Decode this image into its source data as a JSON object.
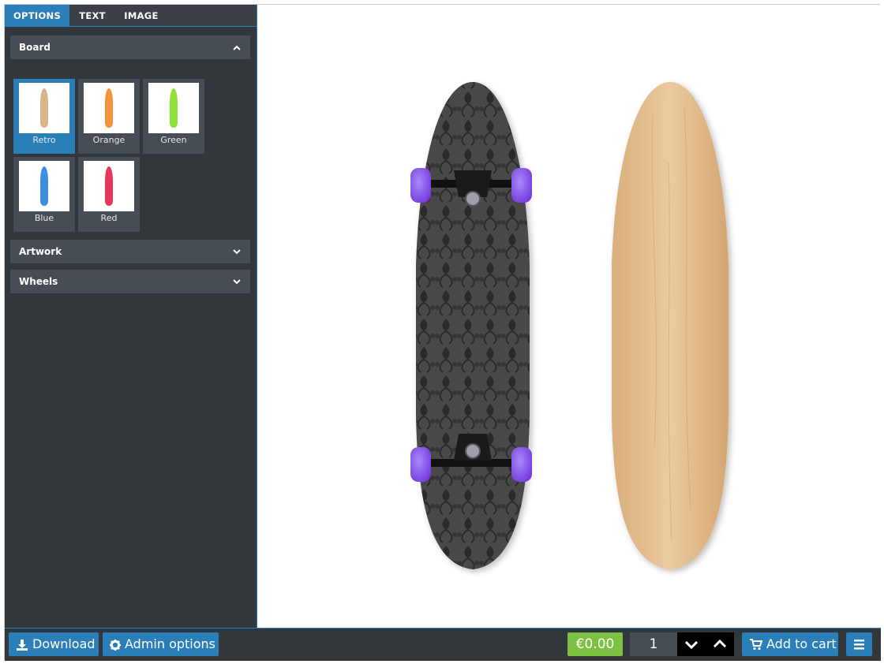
{
  "tabs": [
    {
      "label": "OPTIONS"
    },
    {
      "label": "TEXT"
    },
    {
      "label": "IMAGE"
    }
  ],
  "panels": {
    "board": {
      "title": "Board",
      "swatches": [
        {
          "label": "Retro",
          "color": "#d9b58a"
        },
        {
          "label": "Orange",
          "color": "#f5923a"
        },
        {
          "label": "Green",
          "color": "#8fe03a"
        },
        {
          "label": "Blue",
          "color": "#3a8fe0"
        },
        {
          "label": "Red",
          "color": "#e8365a"
        }
      ]
    },
    "artwork": {
      "title": "Artwork"
    },
    "wheels": {
      "title": "Wheels"
    }
  },
  "toolbar": {
    "download_label": "Download",
    "admin_label": "Admin options",
    "price": "€0.00",
    "quantity": "1",
    "add_to_cart_label": "Add to cart"
  },
  "colors": {
    "accent": "#2a7fb8",
    "panel_bg": "#32373c",
    "price_green": "#7cc142",
    "wheel_purple": "#8a4de8",
    "deck_wood": "#e2bc8e"
  },
  "icons": [
    "chevron-up-icon",
    "chevron-down-icon",
    "download-icon",
    "gear-icon",
    "cart-icon",
    "menu-icon"
  ]
}
